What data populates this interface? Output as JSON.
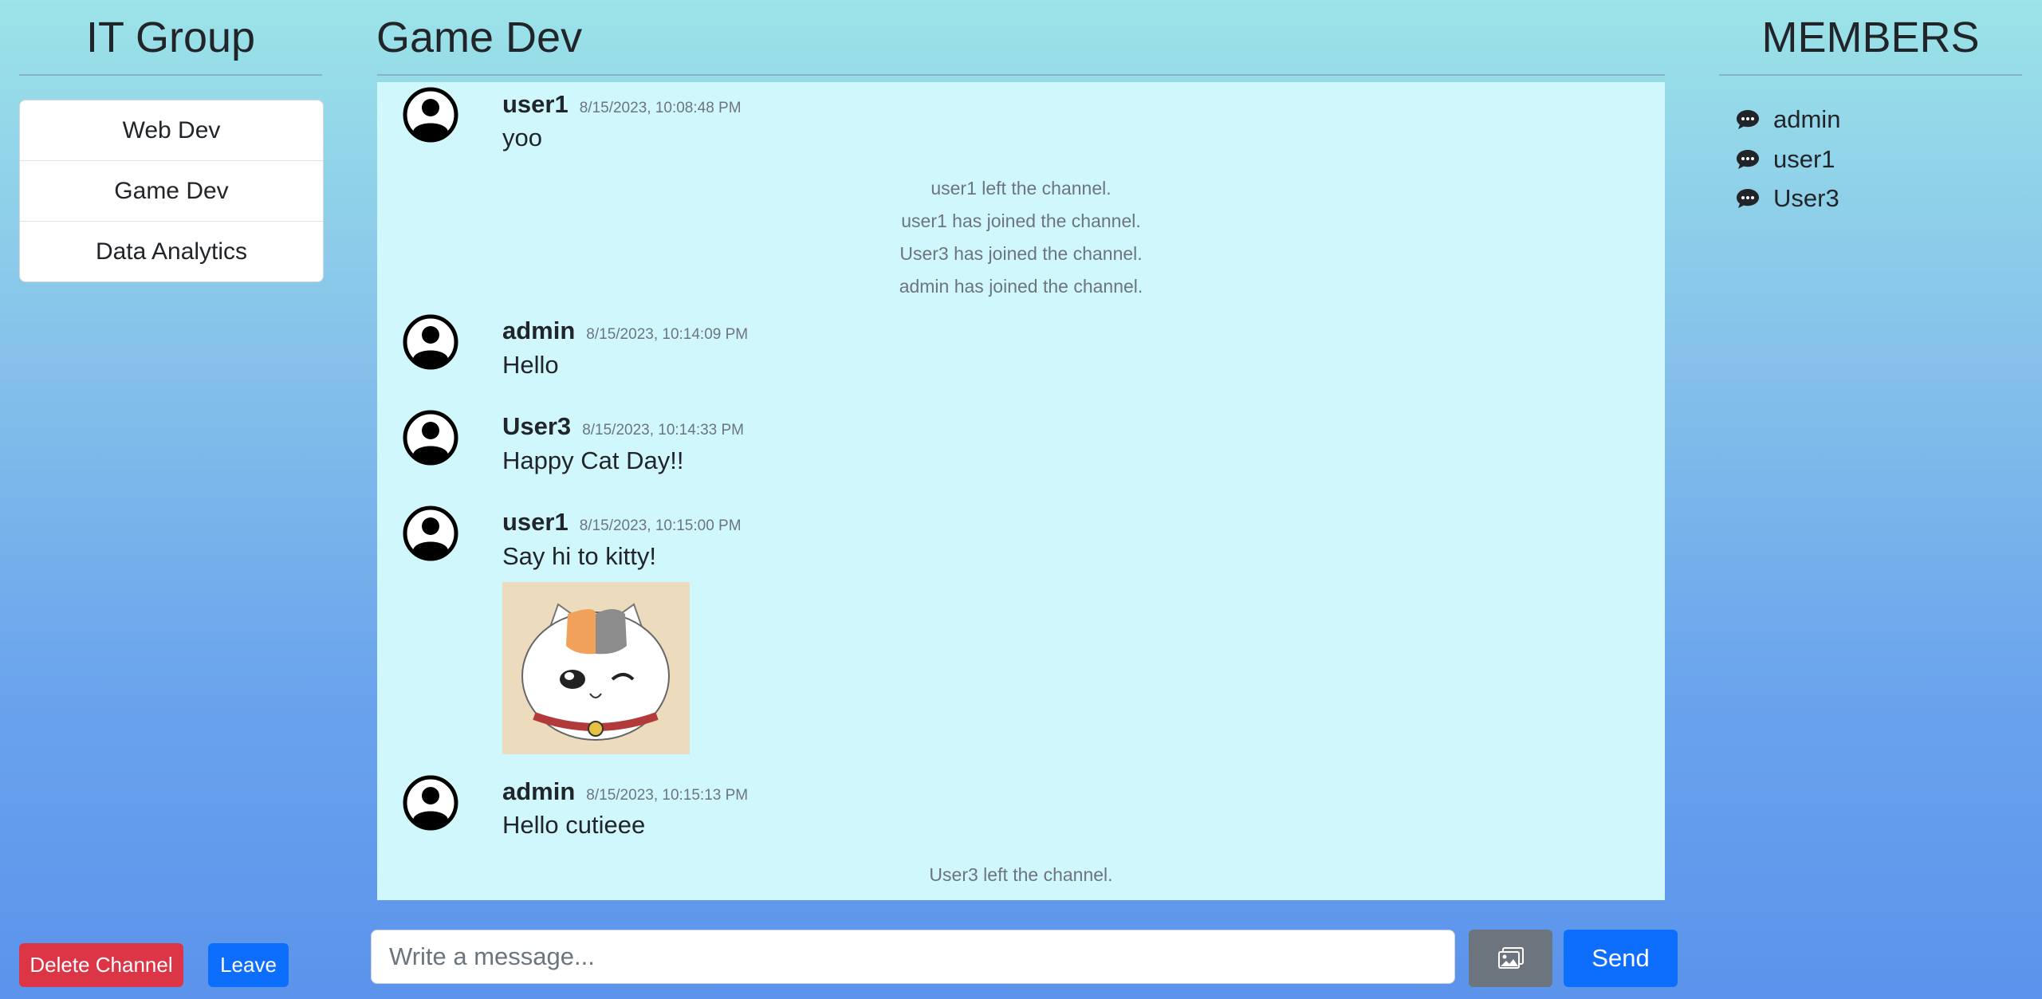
{
  "left_panel": {
    "group_title": "IT Group",
    "channels": [
      {
        "label": "Web Dev"
      },
      {
        "label": "Game Dev"
      },
      {
        "label": "Data Analytics"
      }
    ],
    "delete_label": "Delete Channel",
    "leave_label": "Leave"
  },
  "chat": {
    "title": "Game Dev",
    "messages": [
      {
        "user": "user1",
        "time": "8/15/2023, 10:08:48 PM",
        "text": "yoo"
      },
      {
        "user": "admin",
        "time": "8/15/2023, 10:14:09 PM",
        "text": "Hello"
      },
      {
        "user": "User3",
        "time": "8/15/2023, 10:14:33 PM",
        "text": "Happy Cat Day!!"
      },
      {
        "user": "user1",
        "time": "8/15/2023, 10:15:00 PM",
        "text": "Say hi to kitty!",
        "attachment": "cat-image"
      },
      {
        "user": "admin",
        "time": "8/15/2023, 10:15:13 PM",
        "text": "Hello cutieee"
      }
    ],
    "system_messages": [
      "user1 left the channel.",
      "user1 has joined the channel.",
      "User3 has joined the channel.",
      "admin has joined the channel.",
      "User3 left the channel."
    ],
    "input": {
      "placeholder": "Write a message...",
      "value": ""
    },
    "image_button_icon": "image-icon",
    "send_label": "Send"
  },
  "members": {
    "title": "MEMBERS",
    "icon": "chat-bubble-icon",
    "list": [
      "admin",
      "user1",
      "User3"
    ]
  },
  "colors": {
    "danger": "#dc3545",
    "primary": "#0d6efd",
    "secondary": "#6c757d",
    "chat_bg": "#d0f8fc"
  }
}
